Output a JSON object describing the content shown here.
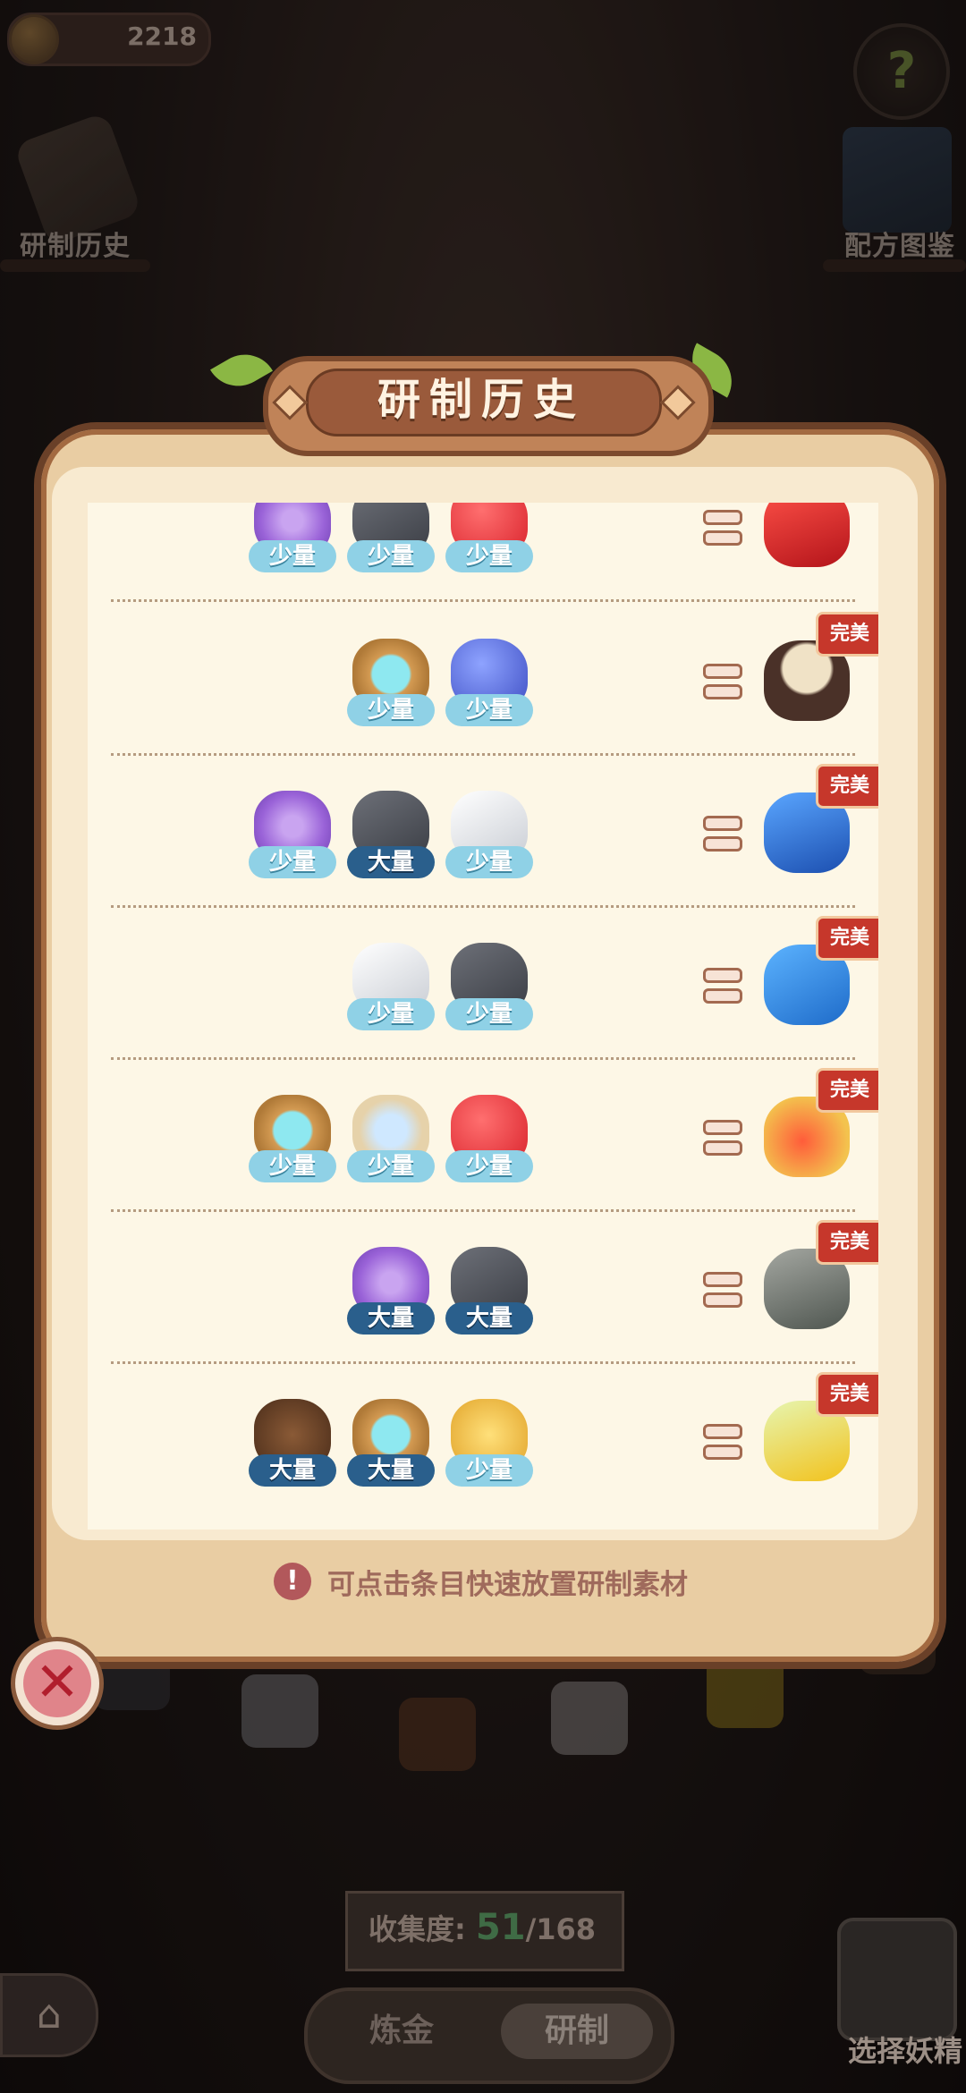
{
  "hud": {
    "coin_value": "2218",
    "help_symbol": "?",
    "history_label": "研制历史",
    "recipe_book_label": "配方图鉴"
  },
  "panel": {
    "title": "研制历史",
    "tip": "可点击条目快速放置研制素材",
    "tip_icon": "!",
    "close_symbol": "✕"
  },
  "entries": [
    {
      "ingredients": [
        {
          "icon": "purple-flower-icon",
          "qty": "少量"
        },
        {
          "icon": "ore-rock-icon",
          "qty": "少量"
        },
        {
          "icon": "red-berry-icon",
          "qty": "少量"
        }
      ],
      "result_icon": "red-potion-icon",
      "badge": ""
    },
    {
      "ingredients": [
        {
          "icon": "water-ring-icon",
          "qty": "少量"
        },
        {
          "icon": "blue-slime-icon",
          "qty": "少量"
        }
      ],
      "result_icon": "stew-bowl-icon",
      "badge": "完美"
    },
    {
      "ingredients": [
        {
          "icon": "purple-flower-icon",
          "qty": "少量"
        },
        {
          "icon": "ore-rock-icon",
          "qty": "大量"
        },
        {
          "icon": "white-crystal-icon",
          "qty": "少量"
        }
      ],
      "result_icon": "blue-potion-icon",
      "badge": "完美"
    },
    {
      "ingredients": [
        {
          "icon": "white-crystal-icon",
          "qty": "少量"
        },
        {
          "icon": "ore-rock-icon",
          "qty": "少量"
        }
      ],
      "result_icon": "blue-ice-cube-icon",
      "badge": "完美"
    },
    {
      "ingredients": [
        {
          "icon": "water-ring-icon",
          "qty": "少量"
        },
        {
          "icon": "salt-pile-icon",
          "qty": "少量"
        },
        {
          "icon": "red-berry-icon",
          "qty": "少量"
        }
      ],
      "result_icon": "red-jar-icon",
      "badge": "完美"
    },
    {
      "ingredients": [
        {
          "icon": "purple-flower-icon",
          "qty": "大量"
        },
        {
          "icon": "ore-rock-icon",
          "qty": "大量"
        }
      ],
      "result_icon": "iron-vase-icon",
      "badge": "完美"
    },
    {
      "ingredients": [
        {
          "icon": "dirt-pile-icon",
          "qty": "大量"
        },
        {
          "icon": "water-ring-icon",
          "qty": "大量"
        },
        {
          "icon": "golden-wheat-icon",
          "qty": "少量"
        }
      ],
      "result_icon": "yellow-potion-icon",
      "badge": "完美"
    }
  ],
  "bottom": {
    "collection_label": "收集度:",
    "collection_current": "51",
    "collection_total": "/168",
    "tab_alchemy": "炼金",
    "tab_research": "研制",
    "active_tab": "研制",
    "summon_label": "选择妖精",
    "home_symbol": "⌂"
  },
  "colors": {
    "qty_small": "#8fd1e6",
    "qty_large": "#2a5f8c",
    "perfect_badge": "#c6372b",
    "panel_bg": "#fdf7e6",
    "panel_frame": "#6a4028"
  }
}
